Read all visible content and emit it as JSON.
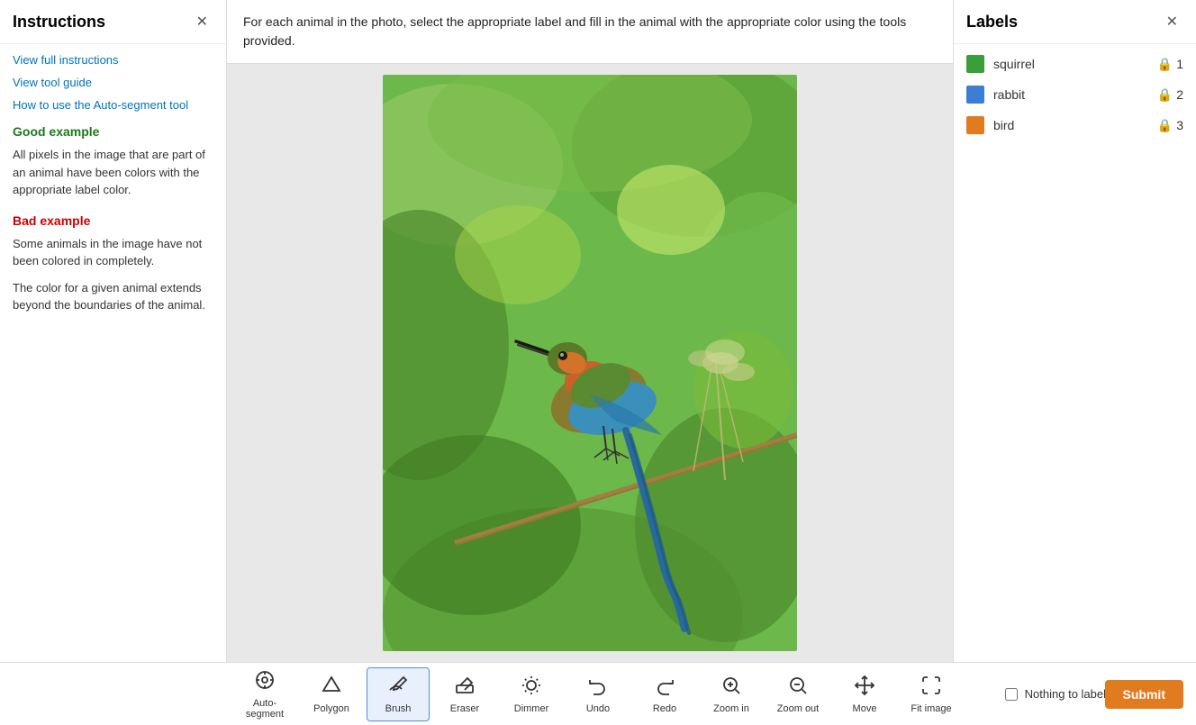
{
  "left_panel": {
    "title": "Instructions",
    "links": [
      {
        "label": "View full instructions",
        "name": "view-full-instructions-link"
      },
      {
        "label": "View tool guide",
        "name": "view-tool-guide-link"
      },
      {
        "label": "How to use the Auto-segment tool",
        "name": "auto-segment-guide-link"
      }
    ],
    "good_example_title": "Good example",
    "good_example_text": "All pixels in the image that are part of an animal have been colors with the appropriate label color.",
    "bad_example_title": "Bad example",
    "bad_example_text1": "Some animals in the image have not been colored in completely.",
    "bad_example_text2": "The color for a given animal extends beyond the boundaries of the animal."
  },
  "instruction_bar": {
    "text": "For each animal in the photo, select the appropriate label and fill in the animal with the appropriate color using the tools provided."
  },
  "right_panel": {
    "title": "Labels",
    "labels": [
      {
        "name": "squirrel",
        "color": "#3a9e3a",
        "number": 1
      },
      {
        "name": "rabbit",
        "color": "#3a7fd4",
        "number": 2
      },
      {
        "name": "bird",
        "color": "#e07b20",
        "number": 3
      }
    ]
  },
  "toolbar": {
    "tools": [
      {
        "label": "Auto-segment",
        "name": "auto-segment-tool",
        "icon": "⊙"
      },
      {
        "label": "Polygon",
        "name": "polygon-tool",
        "icon": "polygon"
      },
      {
        "label": "Brush",
        "name": "brush-tool",
        "icon": "brush",
        "active": true
      },
      {
        "label": "Eraser",
        "name": "eraser-tool",
        "icon": "eraser"
      },
      {
        "label": "Dimmer",
        "name": "dimmer-tool",
        "icon": "dimmer"
      },
      {
        "label": "Undo",
        "name": "undo-tool",
        "icon": "undo"
      },
      {
        "label": "Redo",
        "name": "redo-tool",
        "icon": "redo"
      },
      {
        "label": "Zoom in",
        "name": "zoom-in-tool",
        "icon": "zoom-in"
      },
      {
        "label": "Zoom out",
        "name": "zoom-out-tool",
        "icon": "zoom-out"
      },
      {
        "label": "Move",
        "name": "move-tool",
        "icon": "move"
      },
      {
        "label": "Fit image",
        "name": "fit-image-tool",
        "icon": "fit"
      }
    ],
    "nothing_to_label": "Nothing to label",
    "submit_label": "Submit"
  },
  "colors": {
    "squirrel": "#3a9e3a",
    "rabbit": "#3a7fd4",
    "bird": "#e07b20",
    "good_example": "#1a7a1a",
    "bad_example": "#cc0000",
    "link": "#0073bb",
    "submit_btn": "#e07b20"
  }
}
